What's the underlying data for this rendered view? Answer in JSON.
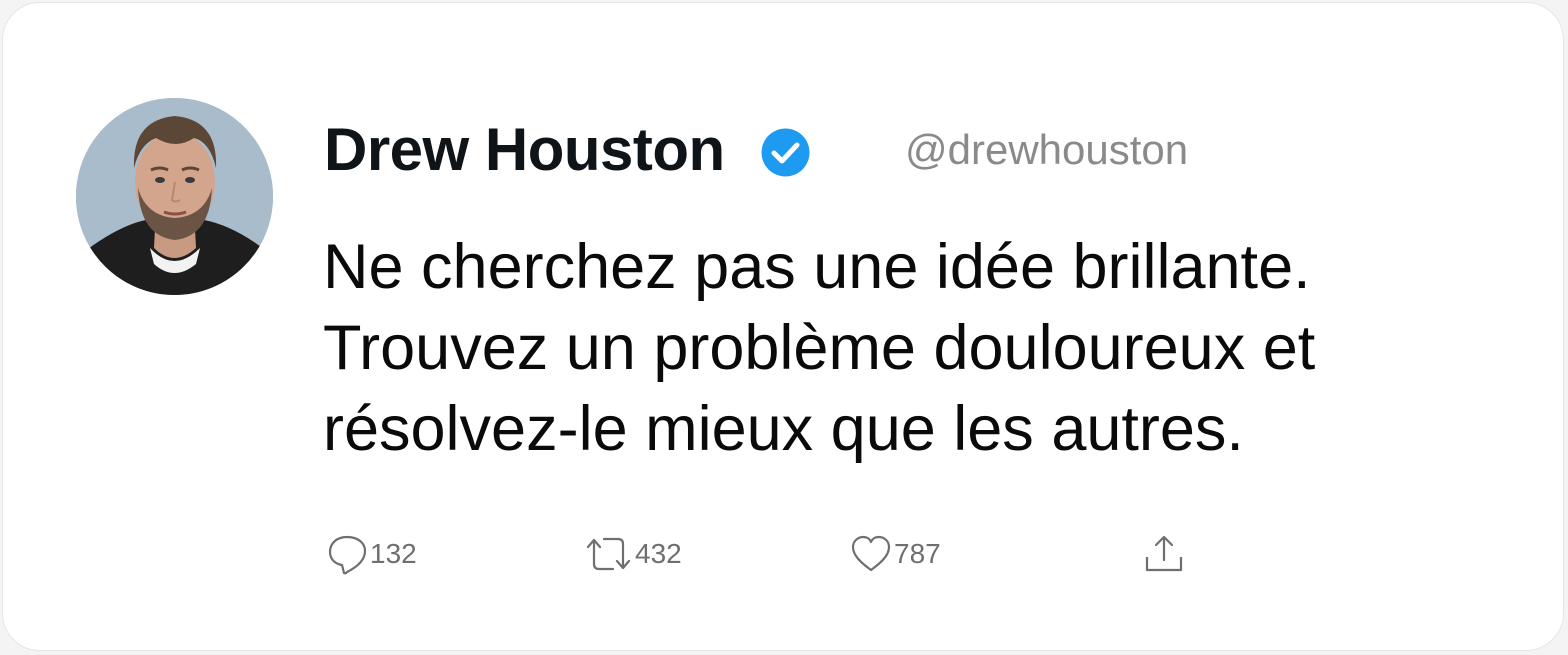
{
  "tweet": {
    "author_name": "Drew Houston",
    "author_handle": "@drewhouston",
    "verified": true,
    "text_lines": [
      "Ne cherchez pas une idée brillante.",
      "Trouvez un problème douloureux et",
      "résolvez-le mieux que les autres."
    ]
  },
  "actions": {
    "reply": {
      "icon": "reply-icon",
      "count": "132"
    },
    "retweet": {
      "icon": "retweet-icon",
      "count": "432"
    },
    "like": {
      "icon": "heart-icon",
      "count": "787"
    },
    "share": {
      "icon": "share-icon"
    }
  },
  "colors": {
    "verified_badge": "#1d9bf0",
    "text": "#0a0a0a",
    "muted": "#8a8a8a"
  }
}
